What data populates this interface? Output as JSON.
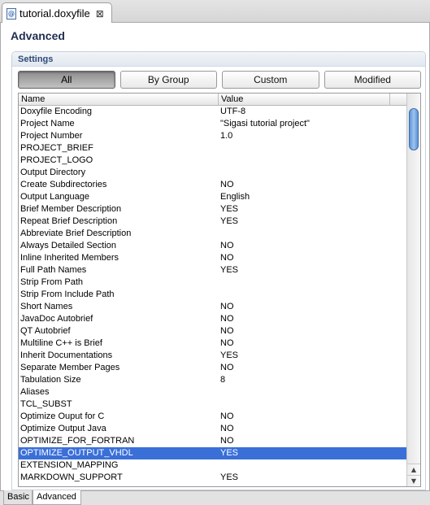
{
  "editor_tab": {
    "title": "tutorial.doxyfile",
    "close_glyph": "⊠",
    "file_glyph": "@"
  },
  "form": {
    "title": "Advanced"
  },
  "section": {
    "title": "Settings"
  },
  "filters": [
    {
      "label": "All",
      "active": true
    },
    {
      "label": "By Group",
      "active": false
    },
    {
      "label": "Custom",
      "active": false
    },
    {
      "label": "Modified",
      "active": false
    }
  ],
  "table": {
    "columns": [
      "Name",
      "Value"
    ],
    "rows": [
      {
        "name": "Doxyfile Encoding",
        "value": "UTF-8"
      },
      {
        "name": "Project Name",
        "value": "\"Sigasi tutorial project\""
      },
      {
        "name": "Project Number",
        "value": "1.0"
      },
      {
        "name": "PROJECT_BRIEF",
        "value": ""
      },
      {
        "name": "PROJECT_LOGO",
        "value": ""
      },
      {
        "name": "Output Directory",
        "value": ""
      },
      {
        "name": "Create Subdirectories",
        "value": "NO"
      },
      {
        "name": "Output Language",
        "value": "English"
      },
      {
        "name": "Brief Member Description",
        "value": "YES"
      },
      {
        "name": "Repeat Brief Description",
        "value": "YES"
      },
      {
        "name": "Abbreviate Brief Description",
        "value": ""
      },
      {
        "name": "Always Detailed Section",
        "value": "NO"
      },
      {
        "name": "Inline Inherited Members",
        "value": "NO"
      },
      {
        "name": "Full Path Names",
        "value": "YES"
      },
      {
        "name": "Strip From Path",
        "value": ""
      },
      {
        "name": "Strip From Include Path",
        "value": ""
      },
      {
        "name": "Short Names",
        "value": "NO"
      },
      {
        "name": "JavaDoc Autobrief",
        "value": "NO"
      },
      {
        "name": "QT Autobrief",
        "value": "NO"
      },
      {
        "name": "Multiline C++ is Brief",
        "value": "NO"
      },
      {
        "name": "Inherit Documentations",
        "value": "YES"
      },
      {
        "name": "Separate Member Pages",
        "value": "NO"
      },
      {
        "name": "Tabulation Size",
        "value": "8"
      },
      {
        "name": "Aliases",
        "value": ""
      },
      {
        "name": "TCL_SUBST",
        "value": ""
      },
      {
        "name": "Optimize Ouput for C",
        "value": "NO"
      },
      {
        "name": "Optimize Output Java",
        "value": "NO"
      },
      {
        "name": "OPTIMIZE_FOR_FORTRAN",
        "value": "NO"
      },
      {
        "name": "OPTIMIZE_OUTPUT_VHDL",
        "value": "YES",
        "selected": true
      },
      {
        "name": "EXTENSION_MAPPING",
        "value": ""
      },
      {
        "name": "MARKDOWN_SUPPORT",
        "value": "YES"
      }
    ]
  },
  "scroll": {
    "up_glyph": "▲",
    "down_glyph": "▼"
  },
  "page_tabs": [
    {
      "label": "Basic",
      "active": false
    },
    {
      "label": "Advanced",
      "active": true
    }
  ],
  "colors": {
    "selection": "#3a6fd8",
    "title": "#1f2e4f",
    "section_title": "#2d4a75"
  }
}
